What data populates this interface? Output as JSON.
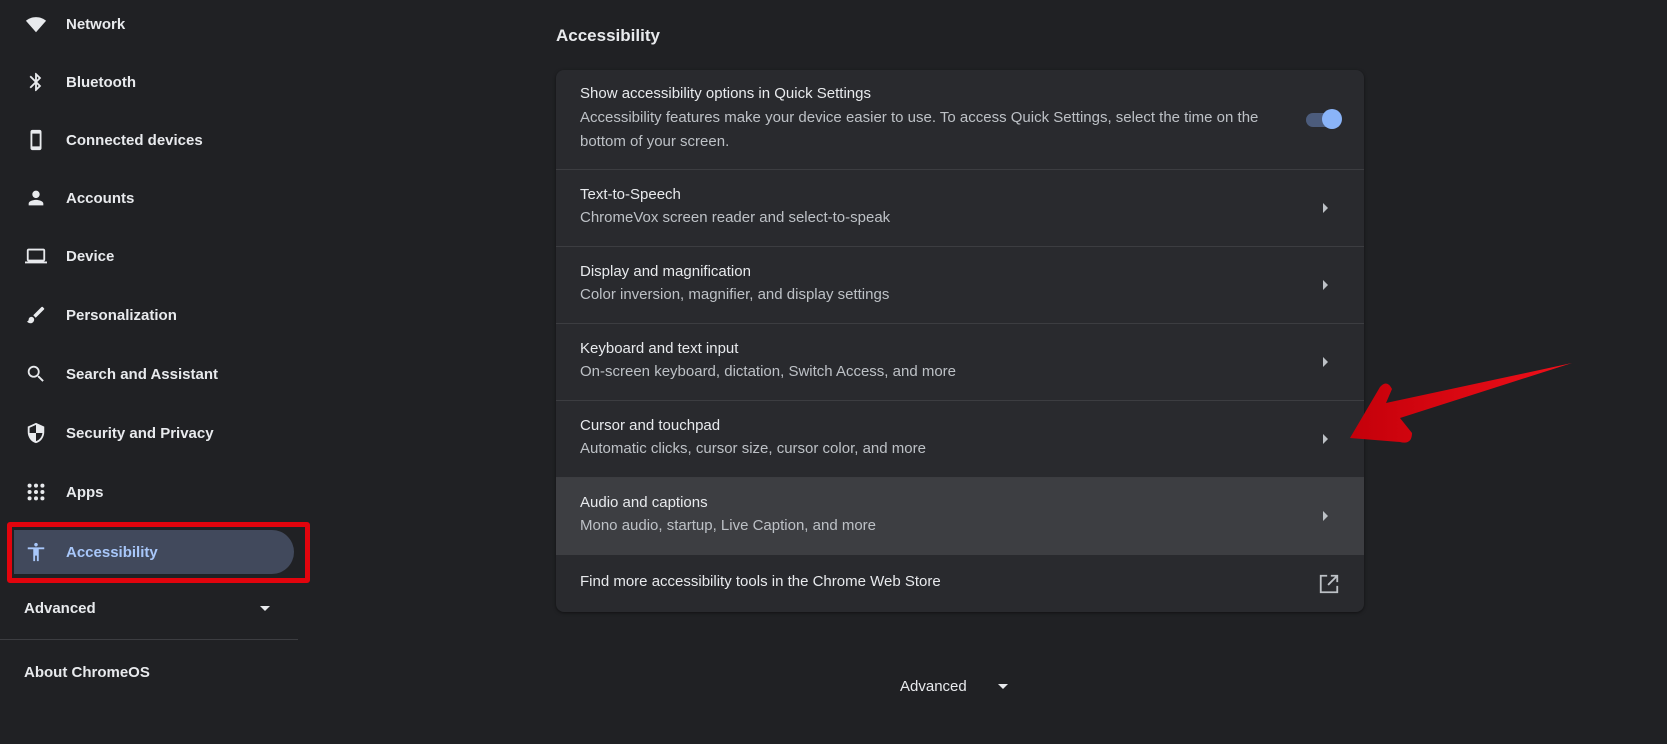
{
  "sidebar": {
    "items": [
      {
        "label": "Network",
        "icon": "wifi-icon"
      },
      {
        "label": "Bluetooth",
        "icon": "bluetooth-icon"
      },
      {
        "label": "Connected devices",
        "icon": "phone-icon"
      },
      {
        "label": "Accounts",
        "icon": "person-icon"
      },
      {
        "label": "Device",
        "icon": "laptop-icon"
      },
      {
        "label": "Personalization",
        "icon": "brush-icon"
      },
      {
        "label": "Search and Assistant",
        "icon": "search-icon"
      },
      {
        "label": "Security and Privacy",
        "icon": "shield-icon"
      },
      {
        "label": "Apps",
        "icon": "apps-grid-icon"
      },
      {
        "label": "Accessibility",
        "icon": "accessibility-icon",
        "active": true
      }
    ],
    "advanced_label": "Advanced",
    "about_label": "About ChromeOS"
  },
  "main": {
    "section_title": "Accessibility",
    "rows": [
      {
        "title": "Show accessibility options in Quick Settings",
        "description": "Accessibility features make your device easier to use. To access Quick Settings, select the time on the bottom of your screen.",
        "control": "toggle",
        "toggle_on": true
      },
      {
        "title": "Text-to-Speech",
        "description": "ChromeVox screen reader and select-to-speak",
        "control": "chevron"
      },
      {
        "title": "Display and magnification",
        "description": "Color inversion, magnifier, and display settings",
        "control": "chevron"
      },
      {
        "title": "Keyboard and text input",
        "description": "On-screen keyboard, dictation, Switch Access, and more",
        "control": "chevron"
      },
      {
        "title": "Cursor and touchpad",
        "description": "Automatic clicks, cursor size, cursor color, and more",
        "control": "chevron"
      },
      {
        "title": "Audio and captions",
        "description": "Mono audio, startup, Live Caption, and more",
        "control": "chevron",
        "hovered": true
      },
      {
        "title": "Find more accessibility tools in the Chrome Web Store",
        "control": "external-link"
      }
    ],
    "advanced_label": "Advanced"
  },
  "colors": {
    "background": "#202124",
    "card": "#292a2e",
    "active_nav": "#41495c",
    "accent": "#8ab4f8",
    "annotation_red": "#e2040d"
  }
}
